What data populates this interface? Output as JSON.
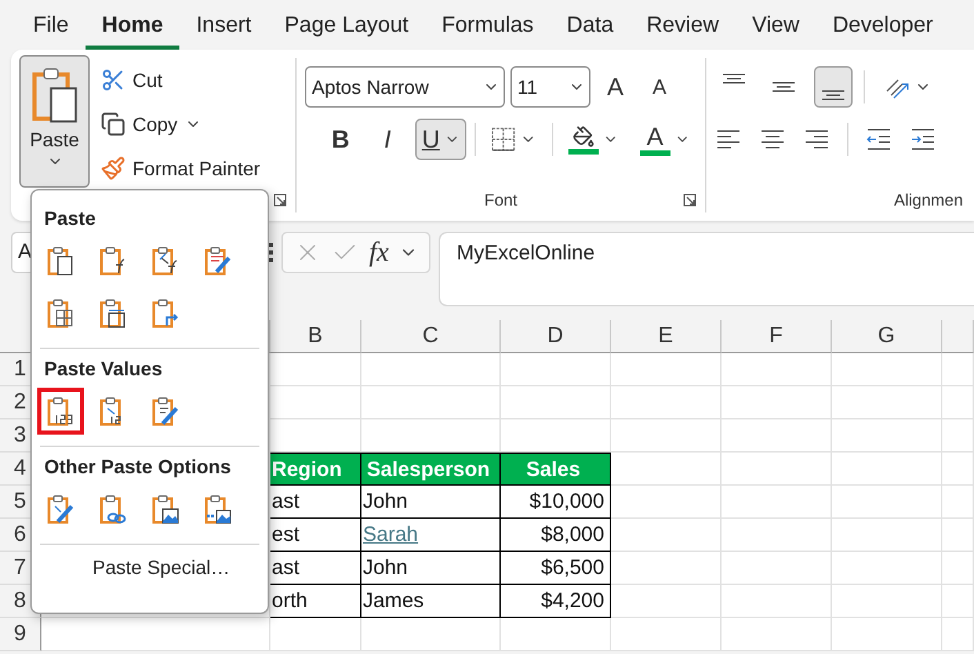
{
  "tabs": [
    {
      "label": "File",
      "selected": false
    },
    {
      "label": "Home",
      "selected": true
    },
    {
      "label": "Insert",
      "selected": false
    },
    {
      "label": "Page Layout",
      "selected": false
    },
    {
      "label": "Formulas",
      "selected": false
    },
    {
      "label": "Data",
      "selected": false
    },
    {
      "label": "Review",
      "selected": false
    },
    {
      "label": "View",
      "selected": false
    },
    {
      "label": "Developer",
      "selected": false
    }
  ],
  "clipboard": {
    "paste": {
      "label": "Paste",
      "pressed": true
    },
    "commands": [
      {
        "kind": "cut",
        "label": "Cut"
      },
      {
        "kind": "copy",
        "label": "Copy"
      },
      {
        "kind": "format-painter",
        "label": "Format Painter"
      }
    ]
  },
  "font": {
    "name": "Aptos Narrow",
    "size": "11",
    "grow_glyph": "A",
    "shrink_glyph": "A",
    "styles": [
      {
        "kind": "bold",
        "glyph": "B",
        "pressed": false
      },
      {
        "kind": "italic",
        "glyph": "I",
        "pressed": false
      },
      {
        "kind": "underline",
        "glyph": "U",
        "pressed": true
      }
    ],
    "font_color_glyph": "A",
    "group_label": "Font"
  },
  "alignment": {
    "vertical": [
      {
        "kind": "top",
        "selected": false
      },
      {
        "kind": "middle",
        "selected": false
      },
      {
        "kind": "bottom",
        "selected": true
      }
    ],
    "group_label": "Alignmen"
  },
  "name_box": "A",
  "formula_bar": {
    "fx": "fx",
    "value": "MyExcelOnline"
  },
  "paste_menu": {
    "sections": [
      {
        "title": "Paste",
        "options": [
          {
            "kind": "all",
            "selected": false
          },
          {
            "kind": "formulas",
            "selected": false
          },
          {
            "kind": "formulas-number",
            "selected": false
          },
          {
            "kind": "keep-source",
            "selected": false
          },
          {
            "kind": "no-borders",
            "selected": false
          },
          {
            "kind": "keep-width",
            "selected": false
          },
          {
            "kind": "transpose",
            "selected": false
          }
        ]
      },
      {
        "title": "Paste Values",
        "options": [
          {
            "kind": "values",
            "selected": true
          },
          {
            "kind": "values-number",
            "selected": false
          },
          {
            "kind": "values-source",
            "selected": false
          }
        ]
      },
      {
        "title": "Other Paste Options",
        "options": [
          {
            "kind": "formatting",
            "selected": false
          },
          {
            "kind": "link",
            "selected": false
          },
          {
            "kind": "picture",
            "selected": false
          },
          {
            "kind": "linked-picture",
            "selected": false
          }
        ]
      }
    ],
    "paste_special": "Paste Special…"
  },
  "sheet": {
    "columns": [
      "B",
      "C",
      "D",
      "E",
      "F",
      "G"
    ],
    "rows": [
      "1",
      "2",
      "3",
      "4",
      "5",
      "6",
      "7",
      "8",
      "9"
    ],
    "table": {
      "headers": [
        "Region",
        "Salesperson",
        "Sales"
      ],
      "rows": [
        {
          "region": "ast",
          "salesperson": {
            "text": "John",
            "hyperlink": false
          },
          "sales": "$10,000"
        },
        {
          "region": "est",
          "salesperson": {
            "text": "Sarah",
            "hyperlink": true
          },
          "sales": "$8,000"
        },
        {
          "region": "ast",
          "salesperson": {
            "text": "John",
            "hyperlink": false
          },
          "sales": "$6,500"
        },
        {
          "region": "orth",
          "salesperson": {
            "text": "James",
            "hyperlink": false
          },
          "sales": "$4,200"
        }
      ]
    }
  }
}
